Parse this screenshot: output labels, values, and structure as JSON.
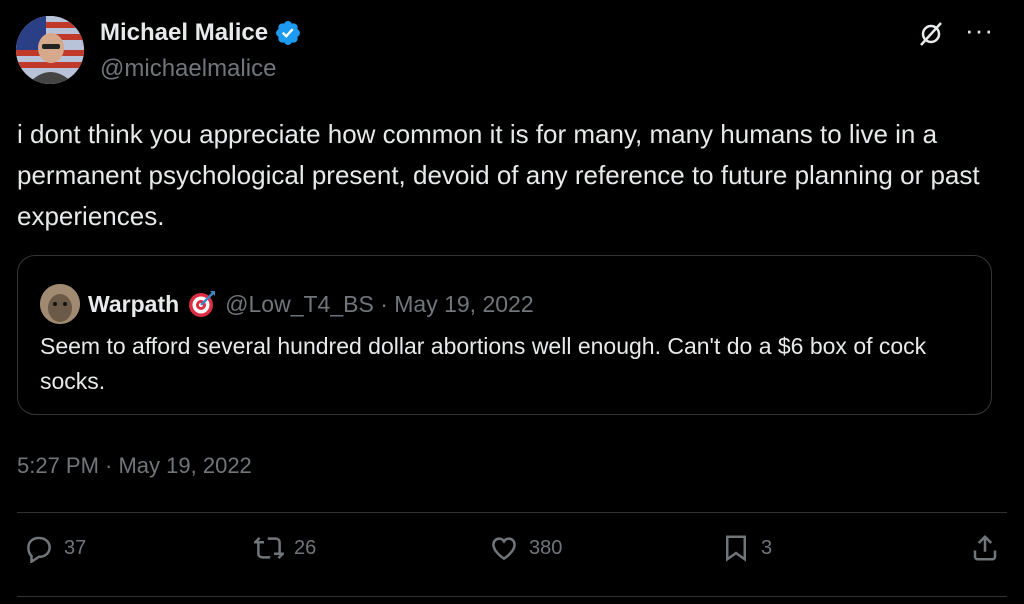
{
  "author": {
    "name": "Michael Malice",
    "handle": "@michaelmalice",
    "avatar_icon": "avatar-person-flag-background",
    "verified_icon": "verified-badge-icon",
    "verified_color": "#1d9bf0"
  },
  "tweet": {
    "text": "i dont think you appreciate how common it is for many, many humans to live in a permanent psychological present, devoid of any reference to future planning or past experiences.",
    "timestamp": "5:27 PM · May 19, 2022"
  },
  "quote": {
    "name": "Warpath",
    "emoji_icon": "direct-hit-target-icon",
    "handle_date": "@Low_T4_BS · May 19, 2022",
    "text": "Seem to afford several hundred dollar abortions well enough. Can't do a $6 box of cock socks."
  },
  "actions": {
    "replies": "37",
    "reposts": "26",
    "likes": "380",
    "bookmarks": "3"
  },
  "colors": {
    "background": "#000000",
    "text": "#e7e9ea",
    "secondary": "#71767b",
    "border": "#333639"
  }
}
